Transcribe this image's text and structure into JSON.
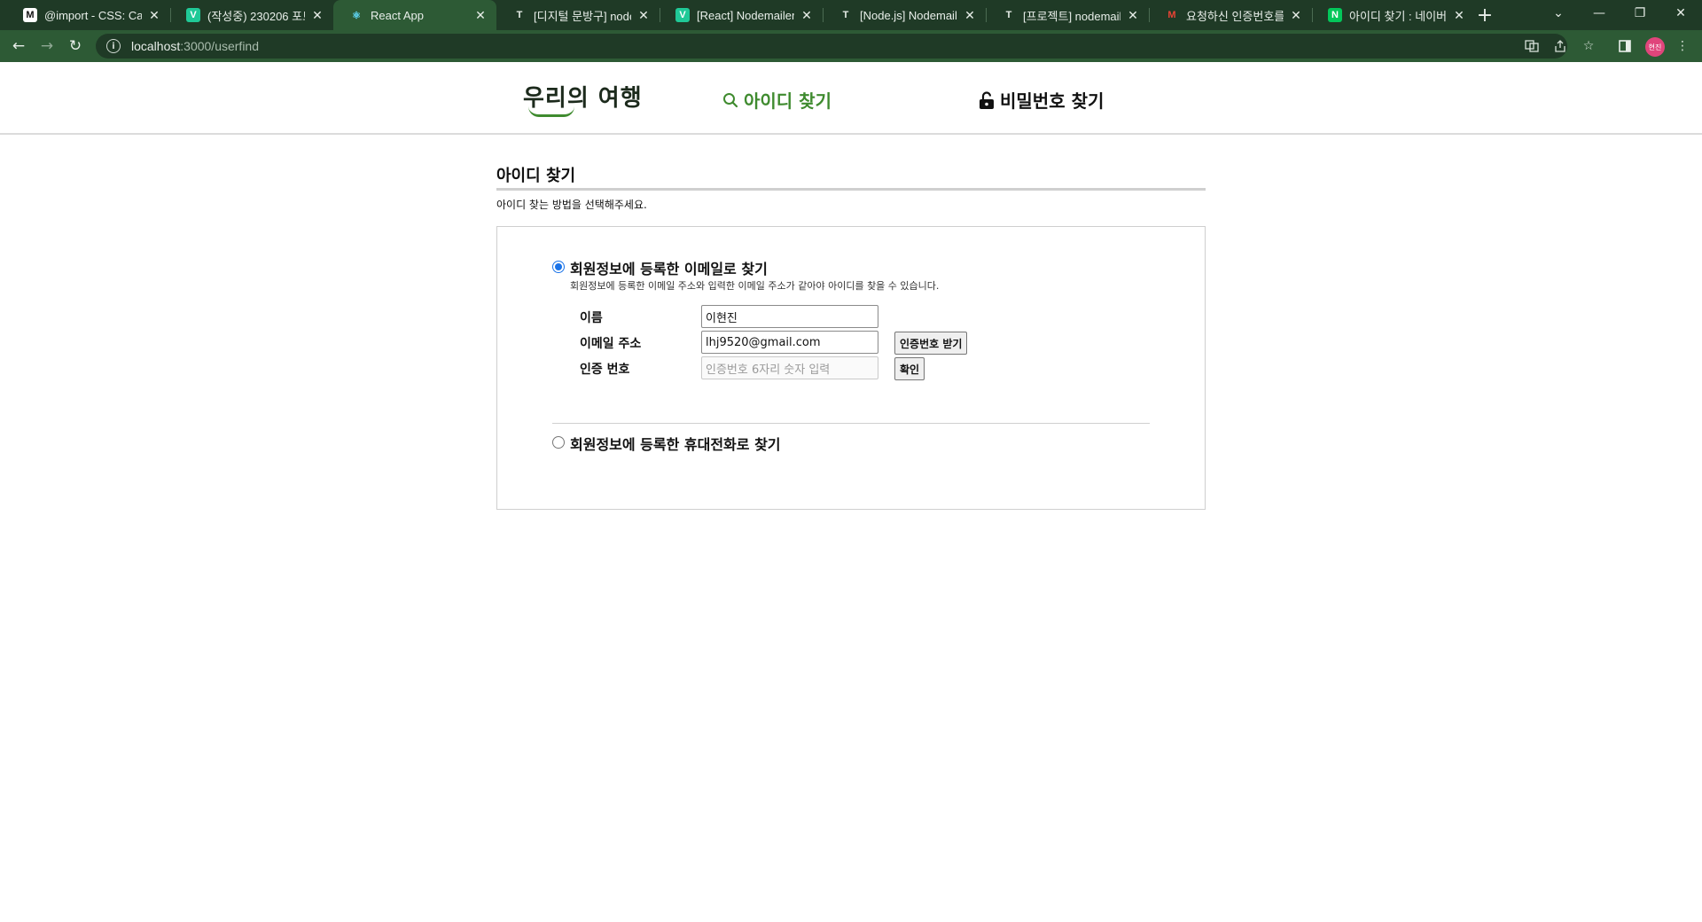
{
  "browser": {
    "tabs": [
      {
        "title": "@import - CSS: Casca",
        "favicon": "M",
        "favicon_color": "#111111",
        "favicon_bg": "#ffffff"
      },
      {
        "title": "(작성중) 230206 포트",
        "favicon": "V",
        "favicon_color": "#ffffff",
        "favicon_bg": "#20c997"
      },
      {
        "title": "React App",
        "favicon": "⚛",
        "favicon_color": "#61dafb",
        "favicon_bg": "transparent"
      },
      {
        "title": "[디지털 문방구] node",
        "favicon": "T",
        "favicon_color": "#e8eee9",
        "favicon_bg": "transparent"
      },
      {
        "title": "[React] Nodemailer G",
        "favicon": "V",
        "favicon_color": "#ffffff",
        "favicon_bg": "#20c997"
      },
      {
        "title": "[Node.js] Nodemailer",
        "favicon": "T",
        "favicon_color": "#e8eee9",
        "favicon_bg": "transparent"
      },
      {
        "title": "[프로젝트] nodemaile",
        "favicon": "T",
        "favicon_color": "#e8eee9",
        "favicon_bg": "transparent"
      },
      {
        "title": "요청하신 인증번호를",
        "favicon": "M",
        "favicon_color": "#ea4335",
        "favicon_bg": "transparent"
      },
      {
        "title": "아이디 찾기 : 네이버",
        "favicon": "N",
        "favicon_color": "#ffffff",
        "favicon_bg": "#03c75a"
      }
    ],
    "url_host": "localhost",
    "url_path": ":3000/userfind",
    "profile_initials": "현진"
  },
  "site": {
    "logo": "우리의 여행",
    "nav_find_id": "아이디 찾기",
    "nav_find_pw": "비밀번호 찾기"
  },
  "section": {
    "title": "아이디 찾기",
    "description": "아이디 찾는 방법을 선택해주세요."
  },
  "email_option": {
    "label": "회원정보에 등록한 이메일로 찾기",
    "sub": "회원정보에 등록한 이메일 주소와 입력한 이메일 주소가 같아야 아이디를 찾을 수 있습니다.",
    "selected": true,
    "name_label": "이름",
    "name_value": "이현진",
    "email_label": "이메일 주소",
    "email_value": "lhj9520@gmail.com",
    "code_label": "인증 번호",
    "code_placeholder": "인증번호 6자리 숫자 입력",
    "send_code_button": "인증번호 받기",
    "confirm_button": "확인"
  },
  "phone_option": {
    "label": "회원정보에 등록한 휴대전화로 찾기",
    "selected": false
  }
}
